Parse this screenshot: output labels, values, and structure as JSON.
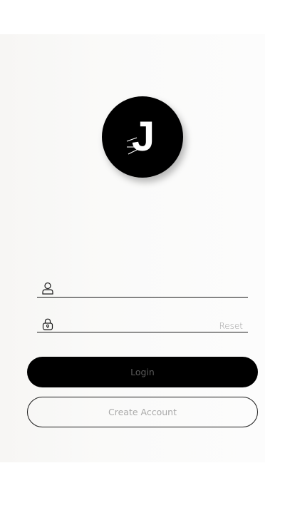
{
  "logo": {
    "letter": "J",
    "icon": "j-logo-icon"
  },
  "username": {
    "placeholder": "",
    "icon": "user-icon"
  },
  "password": {
    "placeholder": "",
    "icon": "lock-icon",
    "reset_label": "Reset"
  },
  "actions": {
    "login_label": "Login",
    "create_account_label": "Create Account"
  },
  "colors": {
    "primary": "#000000",
    "background": "#f9f9f8",
    "muted_text": "#a2a2a2"
  }
}
